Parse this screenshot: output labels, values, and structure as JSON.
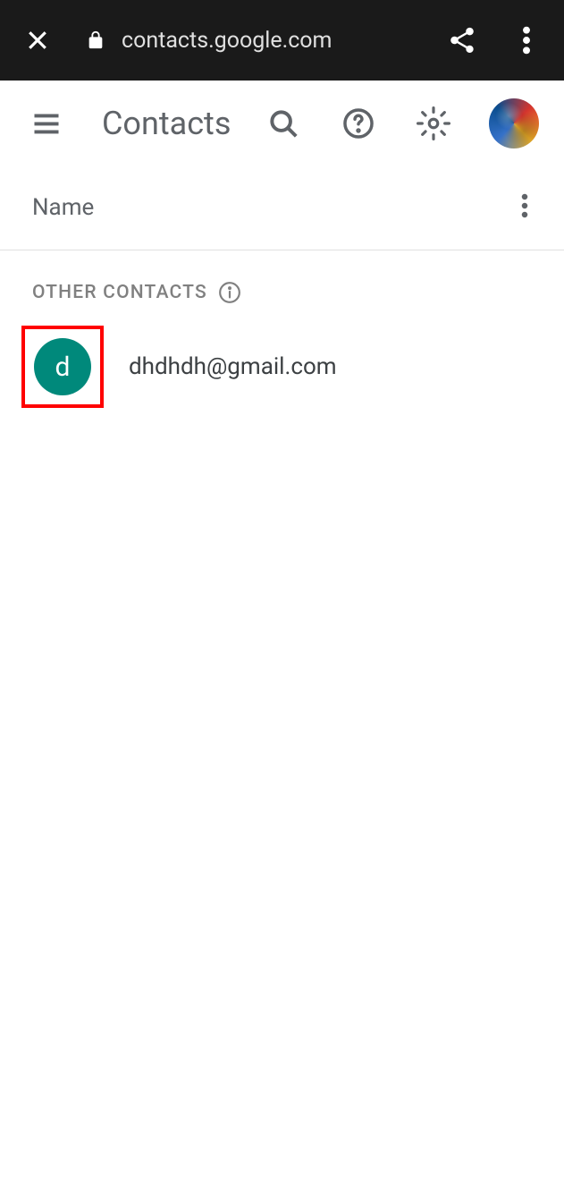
{
  "browser": {
    "url": "contacts.google.com"
  },
  "header": {
    "title": "Contacts"
  },
  "column_header": {
    "name": "Name"
  },
  "section": {
    "label": "OTHER CONTACTS"
  },
  "contacts": [
    {
      "initial": "d",
      "email": "dhdhdh@gmail.com",
      "avatar_color": "#00897b",
      "highlighted": true
    }
  ]
}
